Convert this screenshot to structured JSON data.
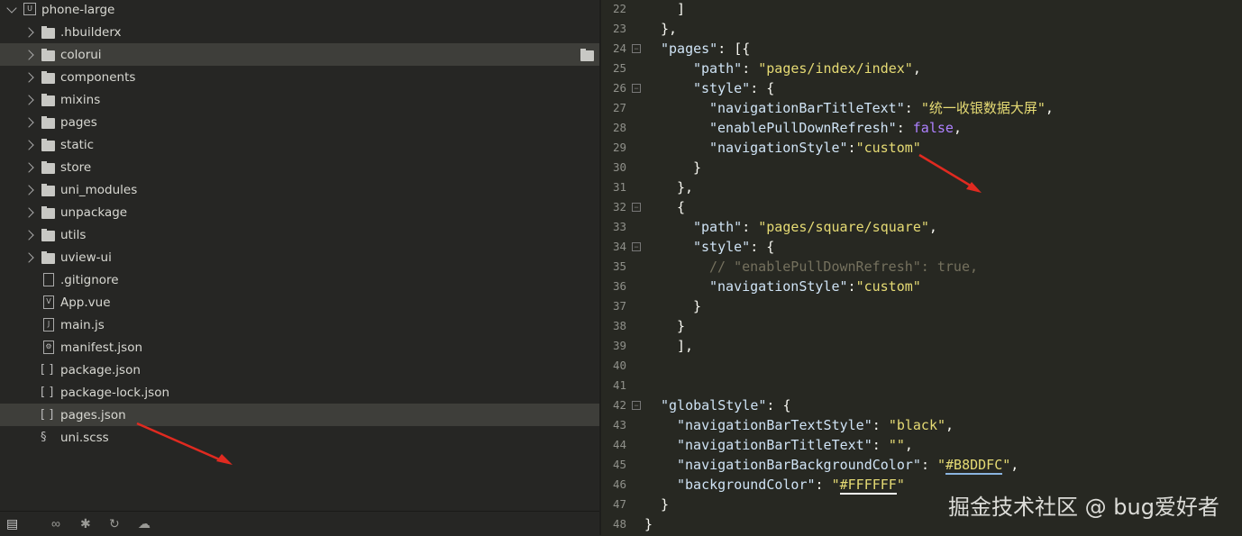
{
  "explorer": {
    "project": "phone-large",
    "items": [
      {
        "label": ".hbuilderx",
        "type": "folder"
      },
      {
        "label": "colorui",
        "type": "folder",
        "hover": true
      },
      {
        "label": "components",
        "type": "folder"
      },
      {
        "label": "mixins",
        "type": "folder"
      },
      {
        "label": "pages",
        "type": "folder"
      },
      {
        "label": "static",
        "type": "folder"
      },
      {
        "label": "store",
        "type": "folder"
      },
      {
        "label": "uni_modules",
        "type": "folder"
      },
      {
        "label": "unpackage",
        "type": "folder"
      },
      {
        "label": "utils",
        "type": "folder"
      },
      {
        "label": "uview-ui",
        "type": "folder"
      },
      {
        "label": ".gitignore",
        "type": "file",
        "icon": ""
      },
      {
        "label": "App.vue",
        "type": "file",
        "icon": "V"
      },
      {
        "label": "main.js",
        "type": "file",
        "icon": "J"
      },
      {
        "label": "manifest.json",
        "type": "file",
        "icon": "⚙"
      },
      {
        "label": "package.json",
        "type": "json"
      },
      {
        "label": "package-lock.json",
        "type": "json"
      },
      {
        "label": "pages.json",
        "type": "json",
        "selected": true
      },
      {
        "label": "uni.scss",
        "type": "scss"
      }
    ],
    "bottom_icons": [
      "files-icon",
      "binoculars-icon",
      "bug-icon",
      "refresh-icon",
      "cloud-icon"
    ]
  },
  "editor": {
    "lines": [
      {
        "n": 22,
        "i": 4,
        "t": [
          [
            "p",
            "]"
          ]
        ]
      },
      {
        "n": 23,
        "i": 2,
        "t": [
          [
            "p",
            "},"
          ]
        ]
      },
      {
        "n": 24,
        "i": 2,
        "f": 1,
        "t": [
          [
            "k",
            "\"pages\""
          ],
          [
            "p",
            ": [{"
          ]
        ]
      },
      {
        "n": 25,
        "i": 6,
        "t": [
          [
            "k",
            "\"path\""
          ],
          [
            "p",
            ": "
          ],
          [
            "s",
            "\"pages/index/index\""
          ],
          [
            "p",
            ","
          ]
        ]
      },
      {
        "n": 26,
        "i": 6,
        "f": 1,
        "t": [
          [
            "k",
            "\"style\""
          ],
          [
            "p",
            ": {"
          ]
        ]
      },
      {
        "n": 27,
        "i": 8,
        "t": [
          [
            "k",
            "\"navigationBarTitleText\""
          ],
          [
            "p",
            ": "
          ],
          [
            "s",
            "\"统一收银数据大屏\""
          ],
          [
            "p",
            ","
          ]
        ]
      },
      {
        "n": 28,
        "i": 8,
        "t": [
          [
            "k",
            "\"enablePullDownRefresh\""
          ],
          [
            "p",
            ": "
          ],
          [
            "b",
            "false"
          ],
          [
            "p",
            ","
          ]
        ]
      },
      {
        "n": 29,
        "i": 8,
        "t": [
          [
            "k",
            "\"navigationStyle\""
          ],
          [
            "p",
            ":"
          ],
          [
            "s",
            "\"custom\""
          ]
        ]
      },
      {
        "n": 30,
        "i": 6,
        "t": [
          [
            "p",
            "}"
          ]
        ]
      },
      {
        "n": 31,
        "i": 4,
        "t": [
          [
            "p",
            "},"
          ]
        ]
      },
      {
        "n": 32,
        "i": 4,
        "f": 1,
        "t": [
          [
            "p",
            "{"
          ]
        ]
      },
      {
        "n": 33,
        "i": 6,
        "t": [
          [
            "k",
            "\"path\""
          ],
          [
            "p",
            ": "
          ],
          [
            "s",
            "\"pages/square/square\""
          ],
          [
            "p",
            ","
          ]
        ]
      },
      {
        "n": 34,
        "i": 6,
        "f": 1,
        "t": [
          [
            "k",
            "\"style\""
          ],
          [
            "p",
            ": {"
          ]
        ]
      },
      {
        "n": 35,
        "i": 8,
        "t": [
          [
            "c",
            "// \"enablePullDownRefresh\": true,"
          ]
        ]
      },
      {
        "n": 36,
        "i": 8,
        "t": [
          [
            "k",
            "\"navigationStyle\""
          ],
          [
            "p",
            ":"
          ],
          [
            "s",
            "\"custom\""
          ]
        ]
      },
      {
        "n": 37,
        "i": 6,
        "t": [
          [
            "p",
            "}"
          ]
        ]
      },
      {
        "n": 38,
        "i": 4,
        "t": [
          [
            "p",
            "}"
          ]
        ]
      },
      {
        "n": 39,
        "i": 4,
        "t": [
          [
            "p",
            "],"
          ]
        ]
      },
      {
        "n": 40,
        "i": 0,
        "t": []
      },
      {
        "n": 41,
        "i": 0,
        "t": []
      },
      {
        "n": 42,
        "i": 2,
        "f": 1,
        "t": [
          [
            "k",
            "\"globalStyle\""
          ],
          [
            "p",
            ": {"
          ]
        ]
      },
      {
        "n": 43,
        "i": 4,
        "t": [
          [
            "k",
            "\"navigationBarTextStyle\""
          ],
          [
            "p",
            ": "
          ],
          [
            "s",
            "\"black\""
          ],
          [
            "p",
            ","
          ]
        ]
      },
      {
        "n": 44,
        "i": 4,
        "t": [
          [
            "k",
            "\"navigationBarTitleText\""
          ],
          [
            "p",
            ": "
          ],
          [
            "s",
            "\"\""
          ],
          [
            "p",
            ","
          ]
        ]
      },
      {
        "n": 45,
        "i": 4,
        "t": [
          [
            "k",
            "\"navigationBarBackgroundColor\""
          ],
          [
            "p",
            ": "
          ],
          [
            "s",
            "\""
          ],
          [
            "s ul1",
            "#B8DDFC"
          ],
          [
            "s",
            "\""
          ],
          [
            "p",
            ","
          ]
        ]
      },
      {
        "n": 46,
        "i": 4,
        "t": [
          [
            "k",
            "\"backgroundColor\""
          ],
          [
            "p",
            ": "
          ],
          [
            "s",
            "\""
          ],
          [
            "s ul2",
            "#FFFFFF"
          ],
          [
            "s",
            "\""
          ]
        ]
      },
      {
        "n": 47,
        "i": 2,
        "t": [
          [
            "p",
            "}"
          ]
        ]
      },
      {
        "n": 48,
        "i": 0,
        "t": [
          [
            "p",
            "}"
          ]
        ]
      }
    ]
  },
  "watermark": "掘金技术社区 @ bug爱好者"
}
